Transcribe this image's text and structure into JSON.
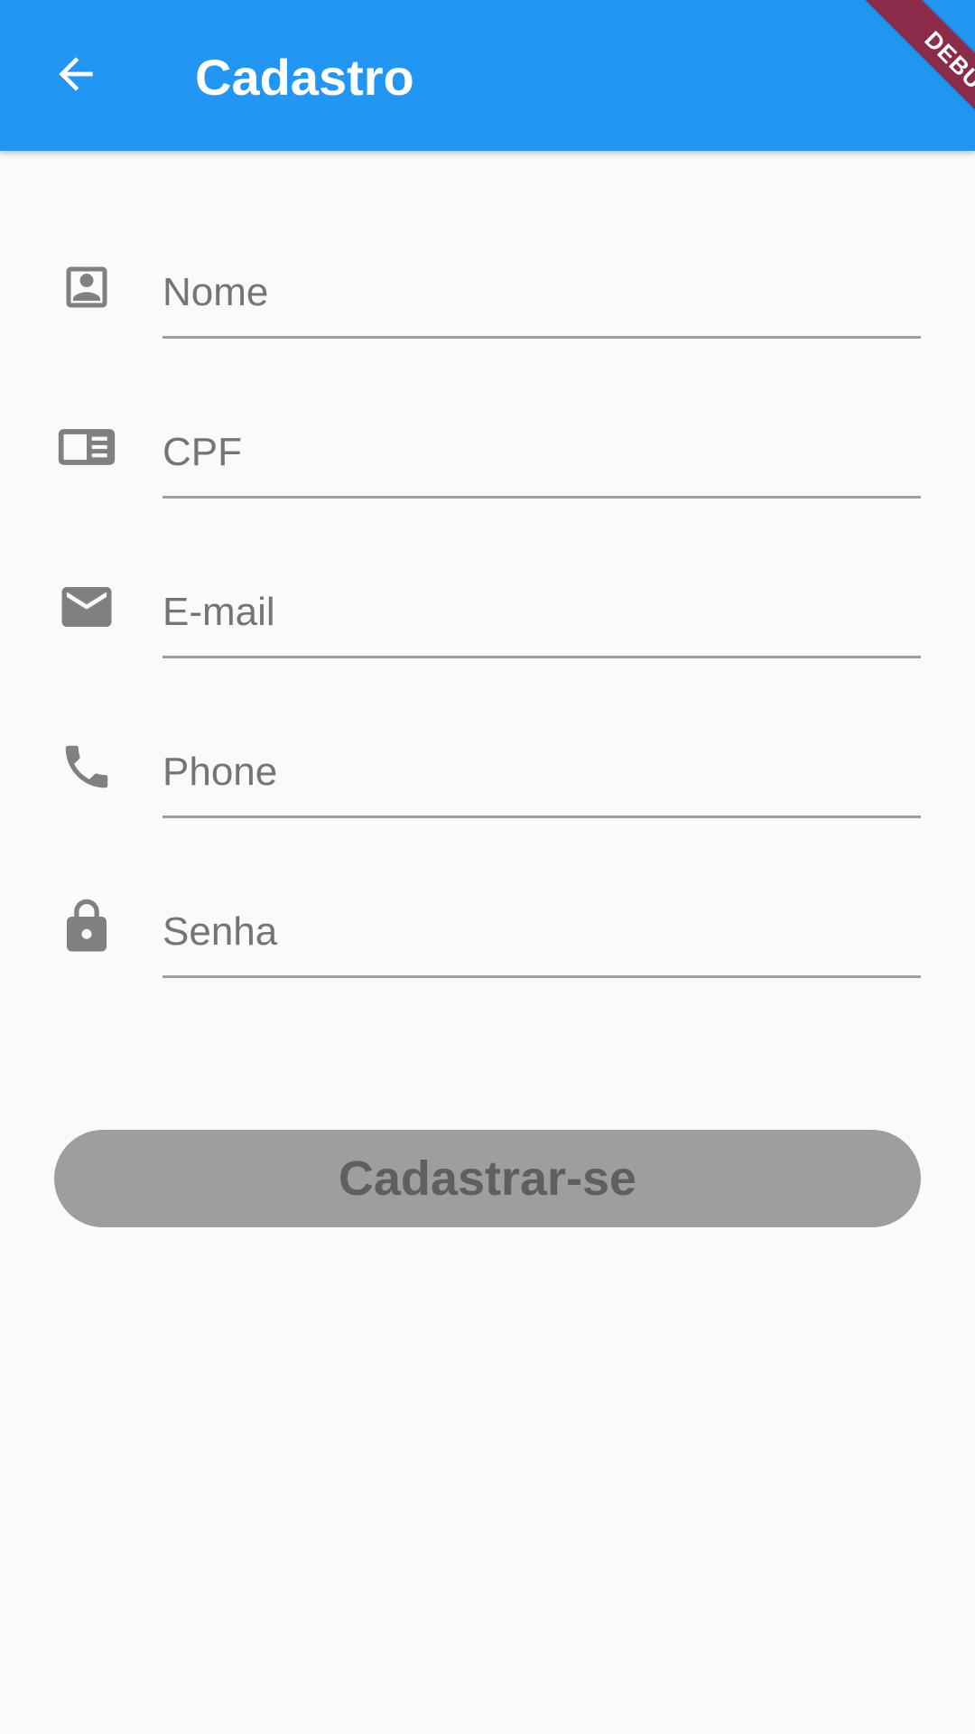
{
  "appbar": {
    "title": "Cadastro",
    "back_icon": "arrow-back-icon",
    "background": "#2196f3"
  },
  "debug_banner": {
    "label": "DEBUG",
    "color": "#8b2c4a"
  },
  "form": {
    "fields": [
      {
        "icon": "contact-card-icon",
        "placeholder": "Nome",
        "value": ""
      },
      {
        "icon": "id-card-icon",
        "placeholder": "CPF",
        "value": ""
      },
      {
        "icon": "mail-icon",
        "placeholder": "E-mail",
        "value": ""
      },
      {
        "icon": "phone-icon",
        "placeholder": "Phone",
        "value": ""
      },
      {
        "icon": "lock-icon",
        "placeholder": "Senha",
        "value": ""
      }
    ],
    "submit_label": "Cadastrar-se",
    "submit_color": "#9e9e9e"
  }
}
